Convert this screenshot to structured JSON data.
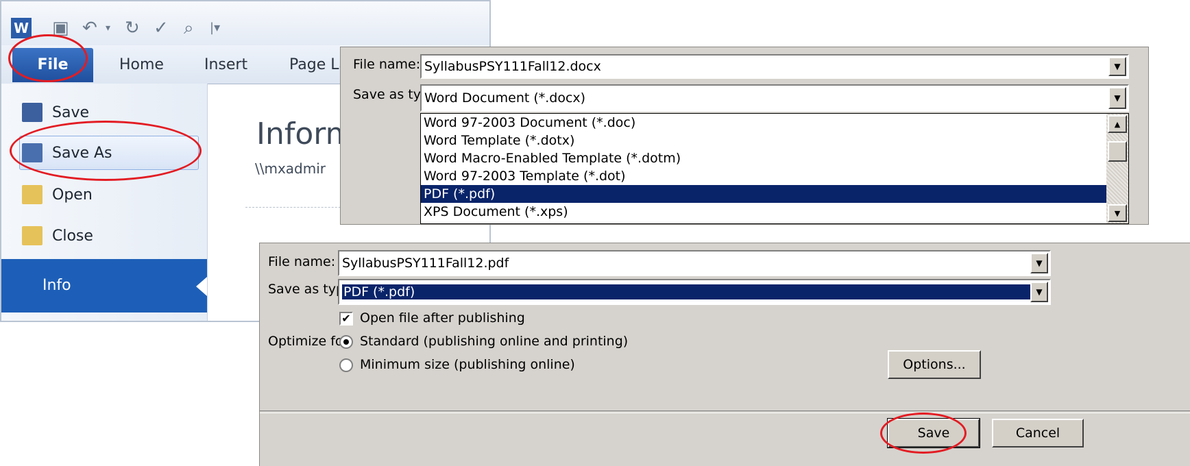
{
  "word": {
    "tabs": {
      "file": "File",
      "home": "Home",
      "insert": "Insert",
      "page_layout": "Page La"
    },
    "nav": {
      "save": "Save",
      "save_as": "Save As",
      "open": "Open",
      "close": "Close",
      "info": "Info"
    },
    "info": {
      "title": "Inform",
      "path": "\\\\mxadmir"
    }
  },
  "dialog1": {
    "filename_label": "File name:",
    "filename_value": "SyllabusPSY111Fall12.docx",
    "type_label": "Save as type:",
    "type_value": "Word Document (*.docx)",
    "type_options": [
      "Word 97-2003 Document (*.doc)",
      "Word Template (*.dotx)",
      "Word Macro-Enabled Template (*.dotm)",
      "Word 97-2003 Template (*.dot)",
      "PDF (*.pdf)",
      "XPS Document (*.xps)"
    ]
  },
  "dialog2": {
    "filename_label": "File name:",
    "filename_value": "SyllabusPSY111Fall12.pdf",
    "type_label": "Save as type:",
    "type_value": "PDF (*.pdf)",
    "open_after": "Open file after publishing",
    "optimize_label": "Optimize for:",
    "standard": "Standard (publishing online and printing)",
    "minimum": "Minimum size (publishing online)",
    "options_btn": "Options...",
    "save_btn": "Save",
    "cancel_btn": "Cancel"
  },
  "colors": {
    "highlight": "#e31c23",
    "selection": "#0a246a",
    "word_blue": "#1d5fb8"
  }
}
